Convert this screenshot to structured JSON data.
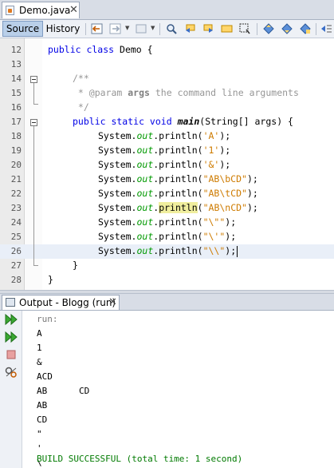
{
  "editor_tab": {
    "title": "Demo.java",
    "close": "✕"
  },
  "toolbar": {
    "source_label": "Source",
    "history_label": "History"
  },
  "code_lines": [
    {
      "num": "12"
    },
    {
      "num": "13"
    },
    {
      "num": "14"
    },
    {
      "num": "15"
    },
    {
      "num": "16"
    },
    {
      "num": "17"
    },
    {
      "num": "18"
    },
    {
      "num": "19"
    },
    {
      "num": "20"
    },
    {
      "num": "21"
    },
    {
      "num": "22"
    },
    {
      "num": "23"
    },
    {
      "num": "24"
    },
    {
      "num": "25"
    },
    {
      "num": "26"
    },
    {
      "num": "27"
    },
    {
      "num": "28"
    }
  ],
  "code": {
    "l12_kw": "public class",
    "l12_rest": " Demo {",
    "l14": "/**",
    "l15_star": " * ",
    "l15_tag": "@param",
    "l15_name": " args",
    "l15_rest": " the command line arguments",
    "l16": " */",
    "l17_kw": "public static void",
    "l17_method": "main",
    "l17_rest": "(String[] args) {",
    "sys": "System.",
    "out": "out",
    "println": ".println(",
    "println_word": "println",
    "close_paren": ");",
    "s18": "'A'",
    "s19": "'1'",
    "s20": "'&'",
    "s21": "\"AB\\bCD\"",
    "s22": "\"AB\\tCD\"",
    "s23": "\"AB\\nCD\"",
    "s24": "\"\\\"\"",
    "s25": "\"\\'\"",
    "s26": "\"\\\\\"",
    "l27": "}",
    "l28": "}"
  },
  "output_tab": {
    "title": "Output - Blogg (run)",
    "close": "✕"
  },
  "output_lines": [
    "run:",
    "A",
    "1",
    "&",
    "ACD",
    "AB      CD",
    "AB",
    "CD",
    "\"",
    "'",
    "\\",
    "BUILD SUCCESSFUL (total time: 1 second)"
  ],
  "colors": {
    "keyword": "#0000e6",
    "string": "#ce7b00",
    "field": "#009900",
    "comment": "#969696",
    "build_success": "#007a00"
  },
  "icons": {
    "toolbar": [
      "back-icon",
      "forward-icon",
      "find-icon",
      "find-prev-icon",
      "find-next-icon",
      "toggle-highlight-icon",
      "toggle-rect-select-icon",
      "prev-bookmark-icon",
      "next-bookmark-icon",
      "toggle-bookmark-icon",
      "shift-left-icon"
    ],
    "output_side": [
      "rerun-icon",
      "rerun-with-params-icon",
      "stop-icon",
      "settings-icon"
    ]
  }
}
